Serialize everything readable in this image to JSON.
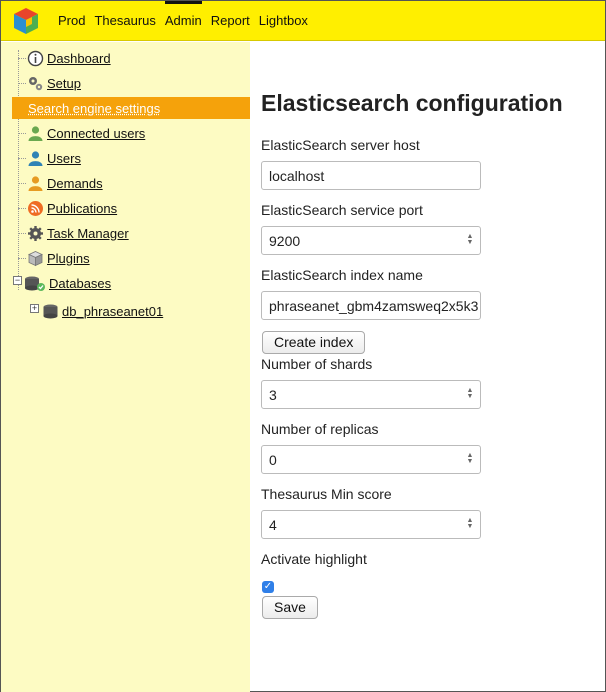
{
  "topnav": {
    "items": [
      {
        "label": "Prod"
      },
      {
        "label": "Thesaurus"
      },
      {
        "label": "Admin"
      },
      {
        "label": "Report"
      },
      {
        "label": "Lightbox"
      }
    ],
    "active": "Admin"
  },
  "sidebar": {
    "items": [
      {
        "label": "Dashboard",
        "icon": "info-icon"
      },
      {
        "label": "Setup",
        "icon": "gears-icon"
      },
      {
        "label": "Search engine settings",
        "icon": "",
        "active": true
      },
      {
        "label": "Connected users",
        "icon": "user-icon"
      },
      {
        "label": "Users",
        "icon": "user-icon"
      },
      {
        "label": "Demands",
        "icon": "user-icon"
      },
      {
        "label": "Publications",
        "icon": "rss-icon"
      },
      {
        "label": "Task Manager",
        "icon": "gear-icon"
      },
      {
        "label": "Plugins",
        "icon": "box-icon"
      }
    ],
    "databases": {
      "label": "Databases",
      "children": [
        {
          "label": "db_phraseanet01"
        }
      ]
    }
  },
  "main": {
    "title": "Elasticsearch configuration",
    "fields": {
      "host": {
        "label": "ElasticSearch server host",
        "value": "localhost"
      },
      "port": {
        "label": "ElasticSearch service port",
        "value": "9200"
      },
      "index": {
        "label": "ElasticSearch index name",
        "value": "phraseanet_gbm4zamsweq2x5k3"
      },
      "shards": {
        "label": "Number of shards",
        "value": "3"
      },
      "replicas": {
        "label": "Number of replicas",
        "value": "0"
      },
      "min_score": {
        "label": "Thesaurus Min score",
        "value": "4"
      },
      "highlight": {
        "label": "Activate highlight",
        "checked": true
      }
    },
    "create_index_label": "Create index",
    "save_label": "Save"
  },
  "colors": {
    "topbar": "#ffef00",
    "sidebar": "#fdfbc3",
    "active_item": "#f5a20b",
    "checkbox": "#2f7fe8"
  }
}
